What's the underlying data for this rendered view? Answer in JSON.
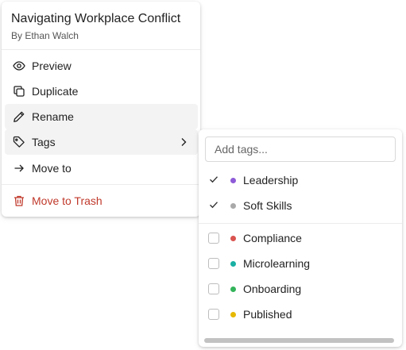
{
  "menu": {
    "title": "Navigating Workplace Conflict",
    "byline": "By Ethan Walch",
    "items": [
      {
        "label": "Preview",
        "icon": "eye-icon"
      },
      {
        "label": "Duplicate",
        "icon": "copy-icon"
      },
      {
        "label": "Rename",
        "icon": "pencil-icon"
      },
      {
        "label": "Tags",
        "icon": "tag-icon"
      },
      {
        "label": "Move to",
        "icon": "arrow-right-icon"
      },
      {
        "label": "Move to Trash",
        "icon": "trash-icon"
      }
    ]
  },
  "tags": {
    "placeholder": "Add tags...",
    "selected": [
      {
        "label": "Leadership",
        "color": "#8e5bd8"
      },
      {
        "label": "Soft Skills",
        "color": "#a9a9a9"
      }
    ],
    "available": [
      {
        "label": "Compliance",
        "color": "#d9534f"
      },
      {
        "label": "Microlearning",
        "color": "#1ab0a3"
      },
      {
        "label": "Onboarding",
        "color": "#33b35a"
      },
      {
        "label": "Published",
        "color": "#e6b800"
      }
    ]
  },
  "colors": {
    "danger": "#c0392b",
    "hover": "#f3f3f3"
  }
}
